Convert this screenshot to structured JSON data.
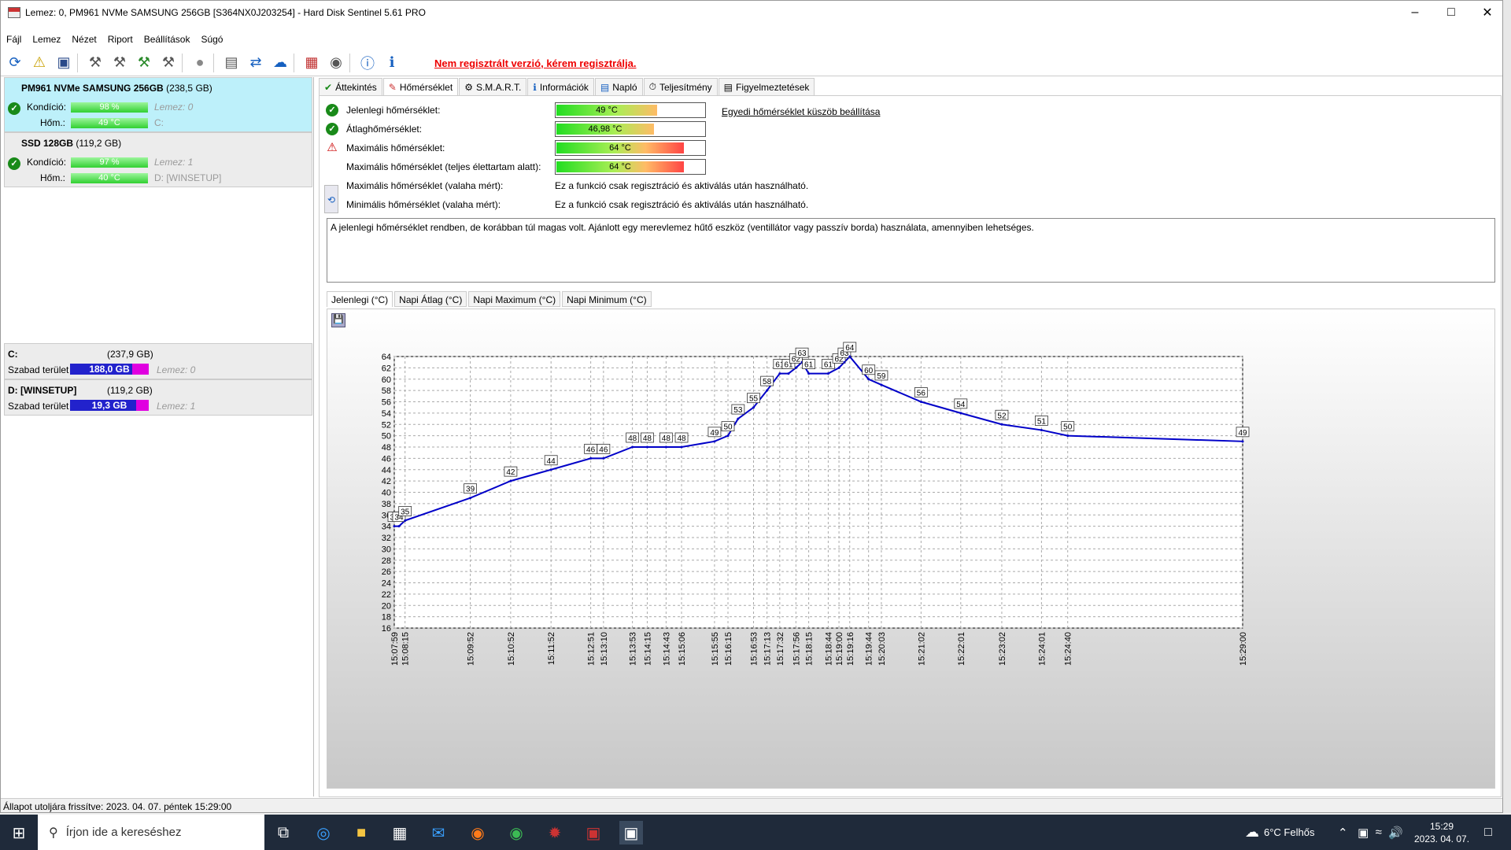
{
  "window": {
    "title": "Lemez: 0, PM961 NVMe SAMSUNG 256GB [S364NX0J203254]  -  Hard Disk Sentinel 5.61 PRO"
  },
  "menu": [
    "Fájl",
    "Lemez",
    "Nézet",
    "Riport",
    "Beállítások",
    "Súgó"
  ],
  "unregistered": "Nem regisztrált verzió, kérem regisztrálja.",
  "disks": [
    {
      "name": "PM961 NVMe SAMSUNG 256GB",
      "size": "(238,5 GB)",
      "health_label": "Kondíció:",
      "health": "98 %",
      "health_pct": 98,
      "disk_ref": "Lemez: 0",
      "temp_label": "Hőm.:",
      "temp": "49 °C",
      "drive": "C:"
    },
    {
      "name": "SSD 128GB",
      "size": "(119,2 GB)",
      "health_label": "Kondíció:",
      "health": "97 %",
      "health_pct": 97,
      "disk_ref": "Lemez: 1",
      "temp_label": "Hőm.:",
      "temp": "40 °C",
      "drive": "D: [WINSETUP]"
    }
  ],
  "volumes": [
    {
      "name": "C:",
      "size": "(237,9 GB)",
      "free_label": "Szabad terület",
      "free": "188,0 GB",
      "disk_ref": "Lemez: 0"
    },
    {
      "name": "D: [WINSETUP]",
      "size": "(119,2 GB)",
      "free_label": "Szabad terület",
      "free": "19,3 GB",
      "disk_ref": "Lemez: 1"
    }
  ],
  "status": "Állapot utoljára frissítve: 2023. 04. 07. péntek 15:29:00",
  "tabs": [
    "Áttekintés",
    "Hőmérséklet",
    "S.M.A.R.T.",
    "Információk",
    "Napló",
    "Teljesítmény",
    "Figyelmeztetések"
  ],
  "temps": {
    "rows": [
      {
        "label": "Jelenlegi hőmérséklet:",
        "value": "49 °C"
      },
      {
        "label": "Átlaghőmérséklet:",
        "value": "46,98 °C"
      },
      {
        "label": "Maximális hőmérséklet:",
        "value": "64 °C"
      },
      {
        "label": "Maximális hőmérséklet (teljes élettartam alatt):",
        "value": "64 °C"
      },
      {
        "label": "Maximális hőmérséklet (valaha mért):",
        "value": "Ez a funkció csak regisztráció és aktiválás után használható."
      },
      {
        "label": "Minimális hőmérséklet (valaha mért):",
        "value": "Ez a funkció csak regisztráció és aktiválás után használható."
      }
    ],
    "link": "Egyedi hőmérséklet küszöb beállítása",
    "note": "A jelenlegi hőmérséklet rendben, de korábban túl magas volt. Ajánlott egy merevlemez hűtő eszköz (ventillátor vagy passzív borda) használata, amennyiben lehetséges."
  },
  "subtabs": [
    "Jelenlegi (°C)",
    "Napi Átlag (°C)",
    "Napi Maximum (°C)",
    "Napi Minimum (°C)"
  ],
  "chart_data": {
    "type": "line",
    "ylim": [
      16,
      64
    ],
    "yticks": [
      16,
      18,
      20,
      22,
      24,
      26,
      28,
      30,
      32,
      34,
      36,
      38,
      40,
      42,
      44,
      46,
      48,
      50,
      52,
      54,
      56,
      58,
      60,
      62,
      64
    ],
    "x": [
      "15:07:59",
      "15:08:15",
      "15:09:52",
      "15:10:52",
      "15:11:52",
      "15:12:51",
      "15:13:10",
      "15:13:53",
      "15:14:15",
      "15:14:43",
      "15:15:06",
      "15:15:55",
      "15:16:15",
      "15:16:53",
      "15:17:13",
      "15:17:32",
      "15:17:56",
      "15:18:15",
      "15:18:44",
      "15:19:00",
      "15:19:16",
      "15:19:44",
      "15:20:03",
      "15:21:02",
      "15:22:01",
      "15:23:02",
      "15:24:01",
      "15:24:40",
      "15:29:00"
    ],
    "series": [
      {
        "values": [
          34,
          35,
          39,
          42,
          44,
          46,
          46,
          48,
          48,
          48,
          48,
          49,
          50,
          53,
          55,
          58,
          61,
          61,
          62,
          63,
          61,
          61,
          62,
          63,
          64,
          60,
          59,
          56,
          54,
          52,
          51,
          50,
          49
        ]
      }
    ],
    "points": [
      {
        "x": "15:07:59",
        "y": 34
      },
      {
        "x": "15:08:06",
        "y": 34
      },
      {
        "x": "15:08:15",
        "y": 35
      },
      {
        "x": "15:09:52",
        "y": 39
      },
      {
        "x": "15:10:52",
        "y": 42
      },
      {
        "x": "15:11:52",
        "y": 44
      },
      {
        "x": "15:12:51",
        "y": 46
      },
      {
        "x": "15:13:10",
        "y": 46
      },
      {
        "x": "15:13:53",
        "y": 48
      },
      {
        "x": "15:14:15",
        "y": 48
      },
      {
        "x": "15:14:43",
        "y": 48
      },
      {
        "x": "15:15:06",
        "y": 48
      },
      {
        "x": "15:15:55",
        "y": 49
      },
      {
        "x": "15:16:15",
        "y": 50
      },
      {
        "x": "15:16:30",
        "y": 53
      },
      {
        "x": "15:16:53",
        "y": 55
      },
      {
        "x": "15:17:13",
        "y": 58
      },
      {
        "x": "15:17:32",
        "y": 61
      },
      {
        "x": "15:17:45",
        "y": 61
      },
      {
        "x": "15:17:56",
        "y": 62
      },
      {
        "x": "15:18:05",
        "y": 63
      },
      {
        "x": "15:18:15",
        "y": 61
      },
      {
        "x": "15:18:44",
        "y": 61
      },
      {
        "x": "15:19:00",
        "y": 62
      },
      {
        "x": "15:19:08",
        "y": 63
      },
      {
        "x": "15:19:16",
        "y": 64
      },
      {
        "x": "15:19:44",
        "y": 60
      },
      {
        "x": "15:20:03",
        "y": 59
      },
      {
        "x": "15:21:02",
        "y": 56
      },
      {
        "x": "15:22:01",
        "y": 54
      },
      {
        "x": "15:23:02",
        "y": 52
      },
      {
        "x": "15:24:01",
        "y": 51
      },
      {
        "x": "15:24:40",
        "y": 50
      },
      {
        "x": "15:29:00",
        "y": 49
      }
    ],
    "grid": true,
    "line_color": "#0000c8"
  },
  "taskbar": {
    "search": "Írjon ide a kereséshez",
    "weather": "6°C  Felhős",
    "time": "15:29",
    "date": "2023. 04. 07."
  }
}
